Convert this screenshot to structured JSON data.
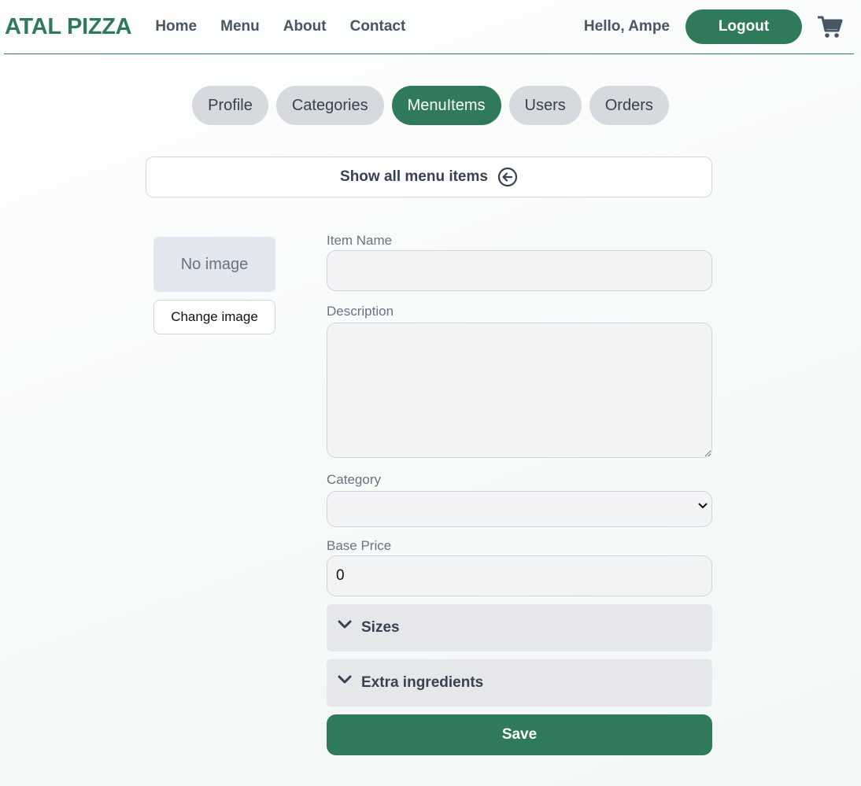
{
  "header": {
    "logo": "ATAL PIZZA",
    "nav": [
      "Home",
      "Menu",
      "About",
      "Contact"
    ],
    "greeting": "Hello, Ampe",
    "logout_label": "Logout",
    "cart_icon": "cart-icon"
  },
  "tabs": [
    {
      "label": "Profile",
      "active": false
    },
    {
      "label": "Categories",
      "active": false
    },
    {
      "label": "MenuItems",
      "active": true
    },
    {
      "label": "Users",
      "active": false
    },
    {
      "label": "Orders",
      "active": false
    }
  ],
  "show_all": {
    "label": "Show all menu items",
    "icon": "arrow-left-circle-icon"
  },
  "image": {
    "placeholder": "No image",
    "change_label": "Change image"
  },
  "form": {
    "item_name_label": "Item Name",
    "item_name_value": "",
    "description_label": "Description",
    "description_value": "",
    "category_label": "Category",
    "category_value": "",
    "base_price_label": "Base Price",
    "base_price_value": "0",
    "sizes_label": "Sizes",
    "extras_label": "Extra ingredients",
    "save_label": "Save"
  },
  "colors": {
    "accent": "#2f7a5a",
    "tab_inactive": "#d6d9de"
  }
}
